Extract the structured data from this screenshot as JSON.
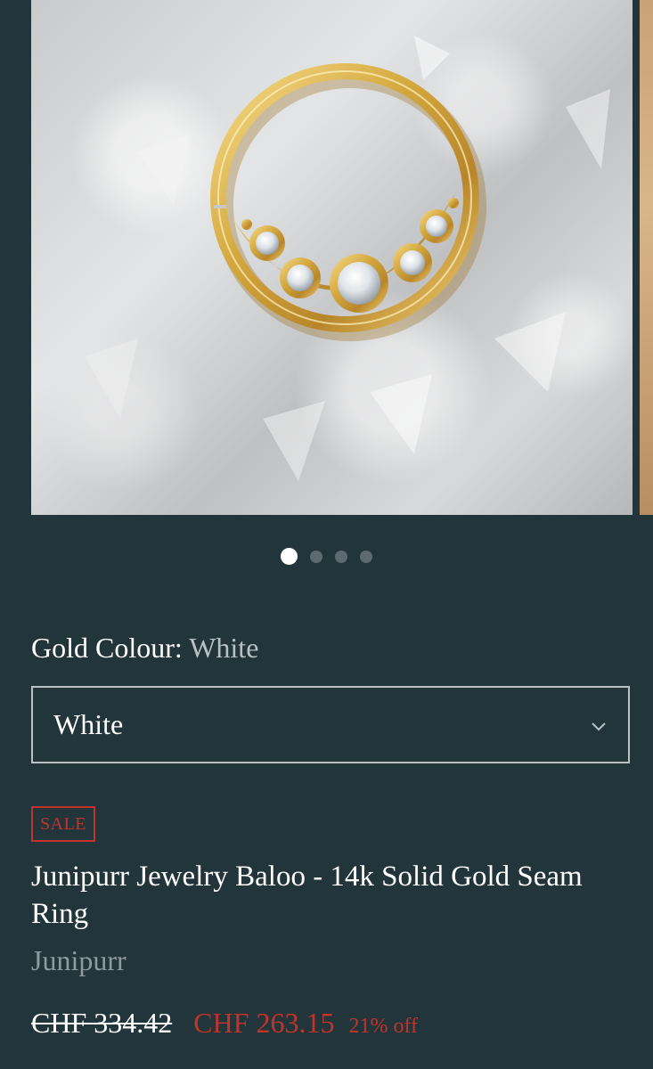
{
  "gallery": {
    "image_alt": "Junipurr Jewelry Baloo - 14k Solid Gold Seam Ring",
    "slide_count": 4,
    "active_slide": 1
  },
  "option": {
    "label": "Gold Colour:",
    "value": "White",
    "select_value": "White"
  },
  "product": {
    "badge": "SALE",
    "title": "Junipurr Jewelry Baloo - 14k Solid Gold Seam Ring",
    "vendor": "Junipurr"
  },
  "price": {
    "compare_at": "CHF 334.42",
    "sale": "CHF 263.15",
    "discount": "21% off"
  },
  "colors": {
    "background": "#22353a",
    "sale_red": "#c0342c",
    "muted_text": "#8f9c9f"
  }
}
